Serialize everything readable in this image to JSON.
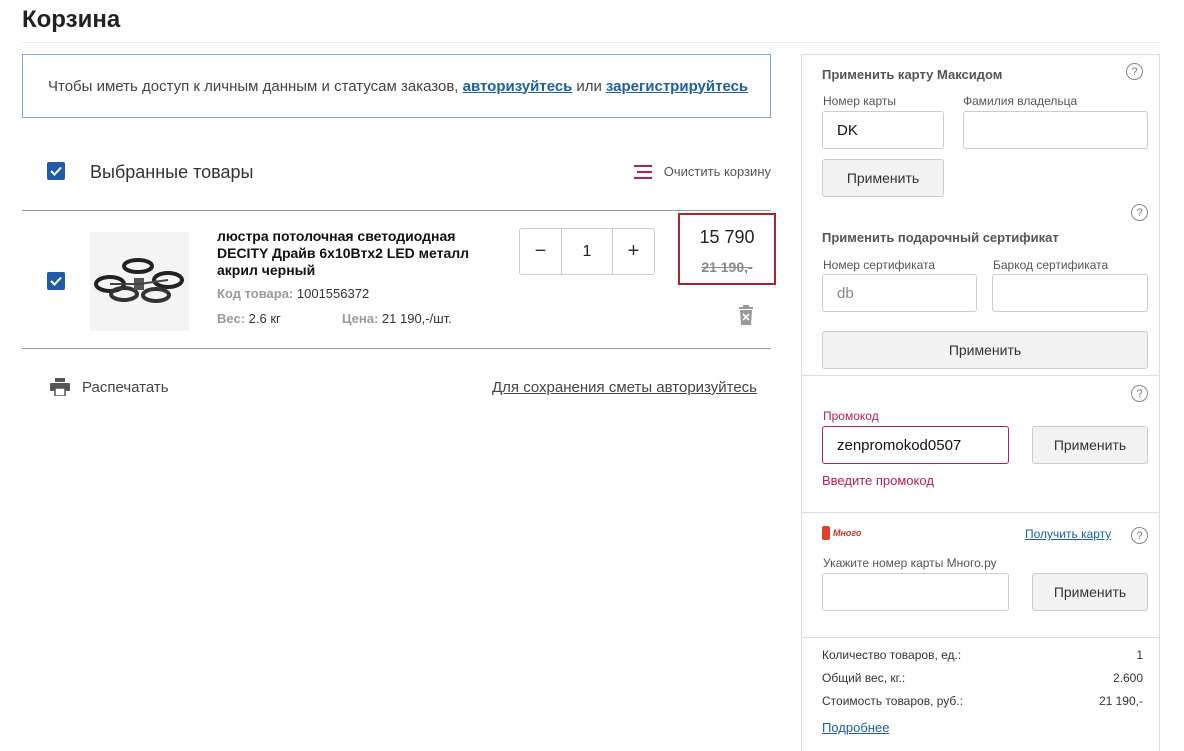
{
  "page": {
    "title": "Корзина"
  },
  "auth_notice": {
    "text": "Чтобы иметь доступ к личным данным и статусам заказов,",
    "login_link": "авторизуйтесь",
    "or": "или",
    "register_link": "зарегистрируйтесь"
  },
  "selection": {
    "label": "Выбранные товары",
    "checked": true,
    "clear_label": "Очистить корзину"
  },
  "item": {
    "checked": true,
    "name": "люстра потолочная светодиодная DECITY Драйв 6x10Втх2 LED металл акрил черный",
    "code_label": "Код товара:",
    "code": "1001556372",
    "weight_label": "Вес:",
    "weight": "2.6 кг",
    "price_label": "Цена:",
    "unit_price": "21 190,-/шт.",
    "qty_minus": "−",
    "qty": "1",
    "qty_plus": "+",
    "price_new": "15 790",
    "price_old": "21 190,-"
  },
  "footer_actions": {
    "print_label": "Распечатать",
    "save_link": "Для сохранения сметы авторизуйтесь"
  },
  "sidebar": {
    "maxidom": {
      "title": "Применить карту Максидом",
      "card_label": "Номер карты",
      "card_value": "DK",
      "owner_label": "Фамилия владельца",
      "owner_value": "",
      "apply": "Применить"
    },
    "gift": {
      "title": "Применить подарочный сертификат",
      "cert_label": "Номер сертификата",
      "cert_placeholder": "db",
      "barcode_label": "Баркод сертификата",
      "barcode_value": "",
      "apply": "Применить"
    },
    "promo": {
      "label": "Промокод",
      "value": "zenpromokod0507",
      "apply": "Применить",
      "error": "Введите промокод"
    },
    "mnogo": {
      "logo_text": "Много",
      "get_card_link": "Получить карту",
      "field_label": "Укажите номер карты Много.ру",
      "field_value": "",
      "apply": "Применить"
    },
    "summary": {
      "rows": [
        {
          "label": "Количество товаров, ед.:",
          "value": "1"
        },
        {
          "label": "Общий вес, кг.:",
          "value": "2.600"
        },
        {
          "label": "Стоимость товаров, руб.:",
          "value": "21 190,-"
        }
      ],
      "details_link": "Подробнее"
    },
    "help_glyph": "?"
  },
  "colors": {
    "accent_blue": "#1e5ba8",
    "alert_red": "#b3222a",
    "promo_red": "#b3224a"
  }
}
